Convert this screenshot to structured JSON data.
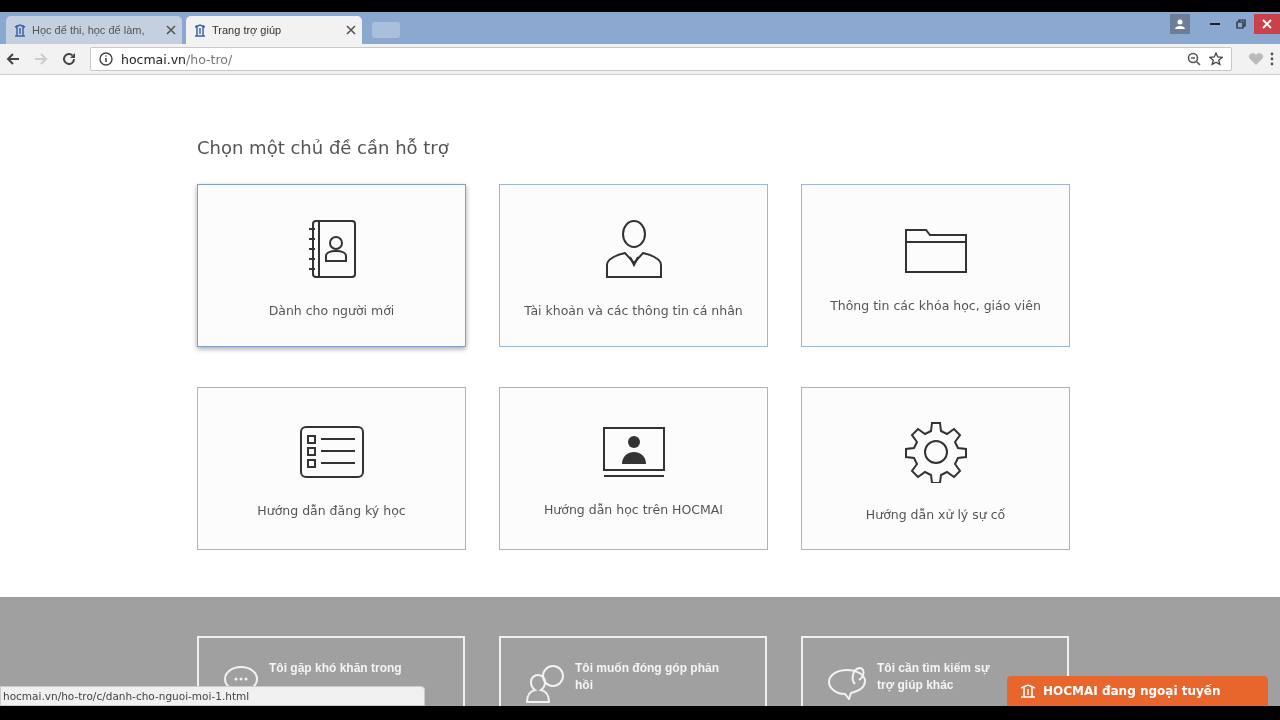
{
  "tabs": [
    {
      "title": "Học để thi, học để làm,",
      "selected": false
    },
    {
      "title": "Trang trợ giúp",
      "selected": true
    }
  ],
  "address": {
    "domain": "hocmai.vn",
    "path": "/ho-tro/"
  },
  "heading": "Chọn một chủ đề cần hỗ trợ",
  "topics": [
    {
      "kind": "contact-book",
      "label": "Dành cho người mới",
      "hovered": true
    },
    {
      "kind": "person",
      "label": "Tài khoản và các thông tin cá nhân",
      "hovered": false
    },
    {
      "kind": "folder",
      "label": "Thông tin các khóa học, giáo viên",
      "hovered": false
    },
    {
      "kind": "list",
      "label": "Hướng dẫn đăng ký học",
      "hovered": false
    },
    {
      "kind": "monitor",
      "label": "Hướng dẫn học trên HOCMAI",
      "hovered": false
    },
    {
      "kind": "gear",
      "label": "Hướng dẫn xử lý sự cố",
      "hovered": false
    }
  ],
  "help_options": [
    {
      "kind": "chat",
      "label": "Tôi gặp khó khăn trong"
    },
    {
      "kind": "feedback",
      "label": "Tôi muốn đóng góp phản hồi"
    },
    {
      "kind": "search",
      "label": "Tôi cần tìm kiếm sự trợ giúp khác"
    }
  ],
  "status_url": "hocmai.vn/ho-tro/c/danh-cho-nguoi-moi-1.html",
  "chat_widget": "HOCMAI đang ngoại tuyến"
}
